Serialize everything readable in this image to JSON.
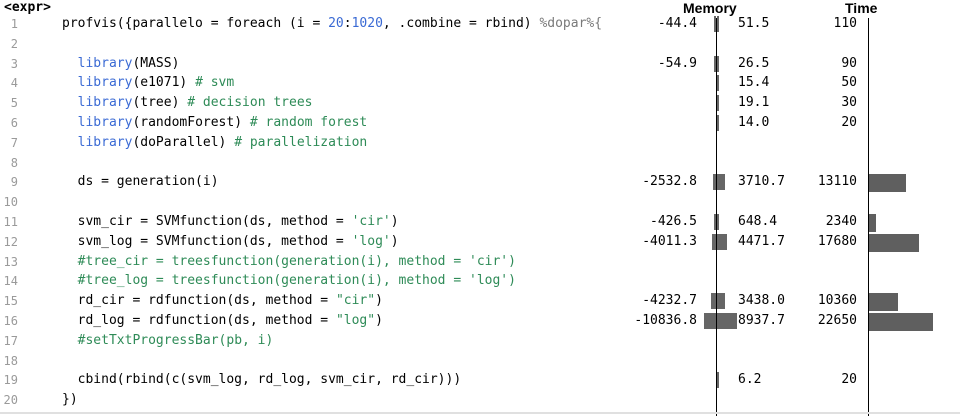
{
  "header": {
    "expr_label": "<expr>",
    "memory_label": "Memory",
    "time_label": "Time"
  },
  "rows": [
    {
      "line": "1",
      "code": "profvis({parallelo = foreach (i = 20:1020, .combine = rbind) %dopar%{",
      "mem_neg": "-44.4",
      "mem_pos": "51.5",
      "time": "110",
      "neg_frac": 0.0042,
      "pos_frac": 0.0058,
      "time_frac": 0.0049
    },
    {
      "line": "2",
      "code": "",
      "mem_neg": "",
      "mem_pos": "",
      "time": "",
      "neg_frac": 0,
      "pos_frac": 0,
      "time_frac": 0
    },
    {
      "line": "3",
      "code": "  library(MASS)",
      "mem_neg": "-54.9",
      "mem_pos": "26.5",
      "time": "90",
      "neg_frac": 0.0051,
      "pos_frac": 0.003,
      "time_frac": 0.004
    },
    {
      "line": "4",
      "code": "  library(e1071) # svm",
      "mem_neg": "",
      "mem_pos": "15.4",
      "time": "50",
      "neg_frac": 0,
      "pos_frac": 0.0017,
      "time_frac": 0.0022
    },
    {
      "line": "5",
      "code": "  library(tree) # decision trees",
      "mem_neg": "",
      "mem_pos": "19.1",
      "time": "30",
      "neg_frac": 0,
      "pos_frac": 0.0021,
      "time_frac": 0.0013
    },
    {
      "line": "6",
      "code": "  library(randomForest) # random forest",
      "mem_neg": "",
      "mem_pos": "14.0",
      "time": "20",
      "neg_frac": 0,
      "pos_frac": 0.0016,
      "time_frac": 0.0009
    },
    {
      "line": "7",
      "code": "  library(doParallel) # parallelization",
      "mem_neg": "",
      "mem_pos": "",
      "time": "",
      "neg_frac": 0,
      "pos_frac": 0,
      "time_frac": 0
    },
    {
      "line": "8",
      "code": "",
      "mem_neg": "",
      "mem_pos": "",
      "time": "",
      "neg_frac": 0,
      "pos_frac": 0,
      "time_frac": 0
    },
    {
      "line": "9",
      "code": "  ds = generation(i)",
      "mem_neg": "-2532.8",
      "mem_pos": "3710.7",
      "time": "13110",
      "neg_frac": 0.2337,
      "pos_frac": 0.4152,
      "time_frac": 0.5788
    },
    {
      "line": "10",
      "code": "",
      "mem_neg": "",
      "mem_pos": "",
      "time": "",
      "neg_frac": 0,
      "pos_frac": 0,
      "time_frac": 0
    },
    {
      "line": "11",
      "code": "  svm_cir = SVMfunction(ds, method = 'cir')",
      "mem_neg": "-426.5",
      "mem_pos": "648.4",
      "time": "2340",
      "neg_frac": 0.0394,
      "pos_frac": 0.0725,
      "time_frac": 0.1033
    },
    {
      "line": "12",
      "code": "  svm_log = SVMfunction(ds, method = 'log')",
      "mem_neg": "-4011.3",
      "mem_pos": "4471.7",
      "time": "17680",
      "neg_frac": 0.3701,
      "pos_frac": 0.5003,
      "time_frac": 0.7806
    },
    {
      "line": "13",
      "code": "  #tree_cir = treesfunction(generation(i), method = 'cir')",
      "mem_neg": "",
      "mem_pos": "",
      "time": "",
      "neg_frac": 0,
      "pos_frac": 0,
      "time_frac": 0
    },
    {
      "line": "14",
      "code": "  #tree_log = treesfunction(generation(i), method = 'log')",
      "mem_neg": "",
      "mem_pos": "",
      "time": "",
      "neg_frac": 0,
      "pos_frac": 0,
      "time_frac": 0
    },
    {
      "line": "15",
      "code": "  rd_cir = rdfunction(ds, method = \"cir\")",
      "mem_neg": "-4232.7",
      "mem_pos": "3438.0",
      "time": "10360",
      "neg_frac": 0.3905,
      "pos_frac": 0.3847,
      "time_frac": 0.4574
    },
    {
      "line": "16",
      "code": "  rd_log = rdfunction(ds, method = \"log\")",
      "mem_neg": "-10836.8",
      "mem_pos": "8937.7",
      "time": "22650",
      "neg_frac": 1.0,
      "pos_frac": 1.0,
      "time_frac": 1.0
    },
    {
      "line": "17",
      "code": "  #setTxtProgressBar(pb, i)",
      "mem_neg": "",
      "mem_pos": "",
      "time": "",
      "neg_frac": 0,
      "pos_frac": 0,
      "time_frac": 0
    },
    {
      "line": "18",
      "code": "",
      "mem_neg": "",
      "mem_pos": "",
      "time": "",
      "neg_frac": 0,
      "pos_frac": 0,
      "time_frac": 0
    },
    {
      "line": "19",
      "code": "  cbind(rbind(c(svm_log, rd_log, svm_cir, rd_cir)))",
      "mem_neg": "",
      "mem_pos": "6.2",
      "time": "20",
      "neg_frac": 0,
      "pos_frac": 0.0007,
      "time_frac": 0.0009
    },
    {
      "line": "20",
      "code": "})",
      "mem_neg": "",
      "mem_pos": "",
      "time": "",
      "neg_frac": 0,
      "pos_frac": 0,
      "time_frac": 0
    }
  ]
}
